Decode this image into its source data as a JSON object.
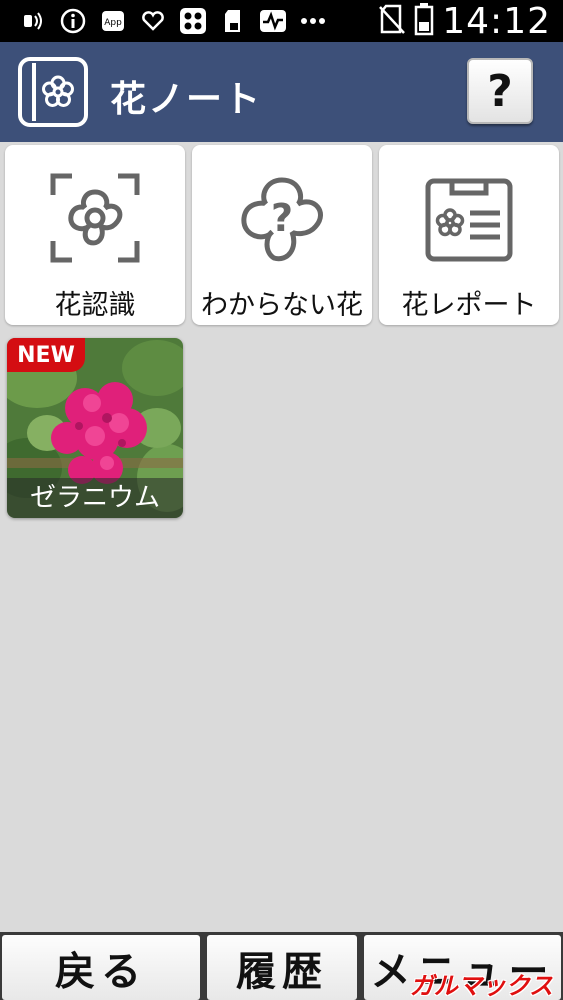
{
  "status_bar": {
    "time": "14:12",
    "icons": [
      "nfc-icon",
      "info-icon",
      "app-icon",
      "heart-cloud-icon",
      "apps-grid-icon",
      "sd-card-icon",
      "activity-icon",
      "more-icon"
    ],
    "right_icons": [
      "no-sim-icon",
      "battery-icon"
    ]
  },
  "header": {
    "title": "花ノート",
    "help_label": "?",
    "background": "#3d5079"
  },
  "tiles": [
    {
      "label": "花認識"
    },
    {
      "label": "わからない花"
    },
    {
      "label": "花レポート"
    }
  ],
  "records": [
    {
      "badge": "NEW",
      "name": "ゼラニウム"
    }
  ],
  "bottom_nav": {
    "back": "戻る",
    "history": "履歴",
    "menu": "メニュー"
  },
  "watermark": "ガルマックス",
  "colors": {
    "accent": "#3d5079",
    "badge": "#d40d12",
    "icon_gray": "#666666"
  }
}
